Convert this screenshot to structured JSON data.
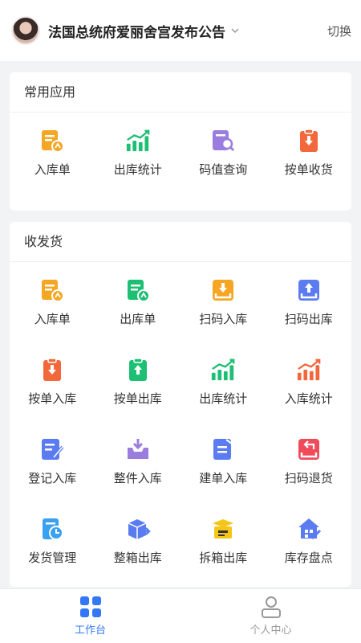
{
  "header": {
    "org_name": "法国总统府爱丽舍宫发布公告",
    "switch_label": "切换"
  },
  "sections": {
    "common": {
      "title": "常用应用",
      "items": [
        {
          "label": "入库单",
          "icon": "inbound-doc-icon",
          "color": "#f5a623"
        },
        {
          "label": "出库统计",
          "icon": "bar-chart-icon",
          "color": "#1dbf73"
        },
        {
          "label": "码值查询",
          "icon": "code-search-icon",
          "color": "#9b7de0"
        },
        {
          "label": "按单收货",
          "icon": "clipboard-down-icon",
          "color": "#f2683c"
        }
      ]
    },
    "shipping": {
      "title": "收发货",
      "items": [
        {
          "label": "入库单",
          "icon": "inbound-doc-icon",
          "color": "#f5a623"
        },
        {
          "label": "出库单",
          "icon": "outbound-doc-icon",
          "color": "#1dbf73"
        },
        {
          "label": "扫码入库",
          "icon": "scan-in-icon",
          "color": "#f5a623"
        },
        {
          "label": "扫码出库",
          "icon": "scan-out-icon",
          "color": "#5b7cf0"
        },
        {
          "label": "按单入库",
          "icon": "clipboard-down-icon",
          "color": "#f2683c"
        },
        {
          "label": "按单出库",
          "icon": "clipboard-up-icon",
          "color": "#1dbf73"
        },
        {
          "label": "出库统计",
          "icon": "bar-chart-icon",
          "color": "#1dbf73"
        },
        {
          "label": "入库统计",
          "icon": "bar-chart-icon",
          "color": "#f2683c"
        },
        {
          "label": "登记入库",
          "icon": "register-icon",
          "color": "#5b7cf0"
        },
        {
          "label": "整件入库",
          "icon": "box-in-icon",
          "color": "#9b7de0"
        },
        {
          "label": "建单入库",
          "icon": "create-doc-icon",
          "color": "#5b7cf0"
        },
        {
          "label": "扫码退货",
          "icon": "scan-return-icon",
          "color": "#f04a5b"
        },
        {
          "label": "发货管理",
          "icon": "shipping-manage-icon",
          "color": "#3aa0f0"
        },
        {
          "label": "整箱出库",
          "icon": "box-out-icon",
          "color": "#5b7cf0"
        },
        {
          "label": "拆箱出库",
          "icon": "unbox-icon",
          "color": "#f5c518"
        },
        {
          "label": "库存盘点",
          "icon": "inventory-icon",
          "color": "#5b7cf0"
        }
      ]
    }
  },
  "tabbar": {
    "items": [
      {
        "label": "工作台",
        "icon": "grid-icon",
        "active": true,
        "color": "#3478f6"
      },
      {
        "label": "个人中心",
        "icon": "user-icon",
        "active": false,
        "color": "#999999"
      }
    ]
  }
}
